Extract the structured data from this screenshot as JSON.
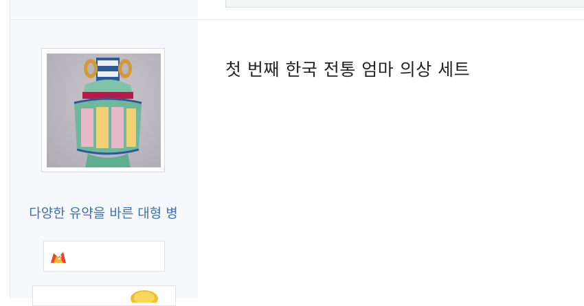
{
  "post": {
    "title": "첫 번째 한국 전통 엄마 의상 세트"
  },
  "author": {
    "name": "다양한 유약을 바른 대형 병",
    "avatar": "vase-avatar-image"
  },
  "colors": {
    "name_link": "#3a6fb5",
    "sidebar_bg": "#f7f8fc",
    "title_text": "#222222"
  }
}
